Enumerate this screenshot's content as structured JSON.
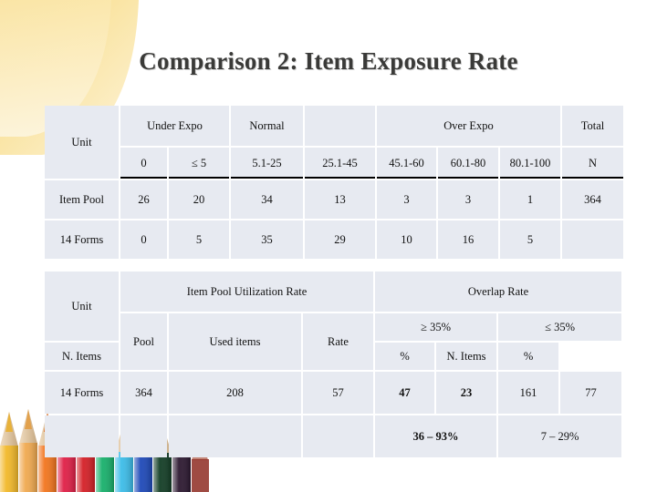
{
  "slide": {
    "title": "Comparison 2: Item Exposure Rate",
    "accent_yellow": "#f7dd8f",
    "cell_bg": "#e7eaf1",
    "highlight_red": "#9e1b1b"
  },
  "exposure_table": {
    "unit_label": "Unit",
    "group_headers": [
      {
        "label": "Under Expo",
        "span": 2
      },
      {
        "label": "Normal",
        "span": 1
      },
      {
        "label": "",
        "span": 1
      },
      {
        "label": "Over Expo",
        "span": 3
      },
      {
        "label": "Total",
        "span": 1
      }
    ],
    "sub_headers": [
      "0",
      "≤ 5",
      "5.1-25",
      "25.1-45",
      "45.1-60",
      "60.1-80",
      "80.1-100",
      "N"
    ],
    "rows": [
      {
        "unit": "Item Pool",
        "values": [
          "26",
          "20",
          "34",
          "13",
          "3",
          "3",
          "1",
          "364"
        ],
        "highlight": [
          false,
          false,
          false,
          false,
          false,
          false,
          false,
          false
        ]
      },
      {
        "unit": "14 Forms",
        "values": [
          "0",
          "5",
          "35",
          "29",
          "10",
          "16",
          "5",
          ""
        ],
        "highlight": [
          false,
          false,
          false,
          true,
          true,
          true,
          true,
          false
        ]
      }
    ]
  },
  "rates_table": {
    "unit_label": "Unit",
    "group_headers": [
      {
        "label": "Item Pool Utilization Rate",
        "span": 3
      },
      {
        "label": "Overlap Rate",
        "span": 4
      }
    ],
    "utilization_sub_headers": [
      "Pool",
      "Used items",
      "Rate"
    ],
    "overlap_groups": [
      {
        "label": "≥ 35%",
        "columns": [
          "N. Items",
          "%"
        ]
      },
      {
        "label": "≤ 35%",
        "columns": [
          "N. Items",
          "%"
        ]
      }
    ],
    "rows": [
      {
        "unit": "14 Forms",
        "pool": "364",
        "used_items": "208",
        "rate": "57",
        "overlap_ge_n_items": "47",
        "overlap_ge_percent": "23",
        "overlap_le_n_items": "161",
        "overlap_le_percent": "77",
        "highlight_ge": true,
        "highlight_le": false
      }
    ],
    "summary_row": {
      "unit": "",
      "pool": "",
      "used_items": "",
      "rate": "",
      "overlap_ge_range": "36 – 93%",
      "overlap_le_range": "7 – 29%",
      "highlight_ge": true,
      "highlight_le": false
    }
  }
}
